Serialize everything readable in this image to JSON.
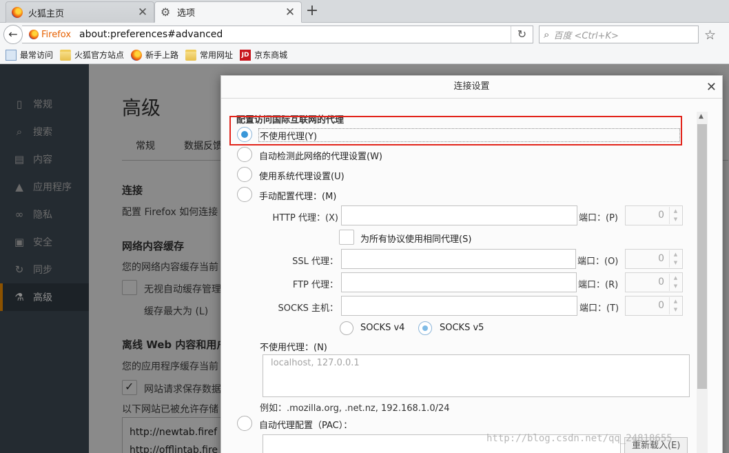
{
  "tabs": [
    {
      "label": "火狐主页",
      "icon": "firefox-logo-icon",
      "close": "✕"
    },
    {
      "label": "选项",
      "icon": "gear-icon",
      "close": "✕"
    }
  ],
  "new_tab_symbol": "+",
  "navbar": {
    "identity_label": "Firefox",
    "url": "about:preferences#advanced",
    "search_placeholder": "百度 <Ctrl+K>"
  },
  "bookmarks": [
    {
      "label": "最常访问",
      "icon": "most-visited-icon"
    },
    {
      "label": "火狐官方站点",
      "icon": "folder-icon"
    },
    {
      "label": "新手上路",
      "icon": "firefox-logo-icon"
    },
    {
      "label": "常用网址",
      "icon": "folder-icon"
    },
    {
      "label": "京东商城",
      "icon": "jd-logo-icon",
      "icon_text": "JD"
    }
  ],
  "sidebar": {
    "items": [
      {
        "label": "常规",
        "icon": "general-icon",
        "glyph": "▯"
      },
      {
        "label": "搜索",
        "icon": "search-icon",
        "glyph": "⌕"
      },
      {
        "label": "内容",
        "icon": "content-icon",
        "glyph": "▤"
      },
      {
        "label": "应用程序",
        "icon": "applications-icon",
        "glyph": "▲"
      },
      {
        "label": "隐私",
        "icon": "privacy-mask-icon",
        "glyph": "∞"
      },
      {
        "label": "安全",
        "icon": "security-lock-icon",
        "glyph": "▣"
      },
      {
        "label": "同步",
        "icon": "sync-icon",
        "glyph": "↻"
      },
      {
        "label": "高级",
        "icon": "advanced-icon",
        "glyph": "⚗",
        "selected": true
      }
    ]
  },
  "pane": {
    "title": "高级",
    "tabs": [
      "常规",
      "数据反馈"
    ],
    "connection_heading": "连接",
    "connection_desc": "配置 Firefox 如何连接",
    "cache_heading": "网络内容缓存",
    "cache_desc": "您的网络内容缓存当前",
    "cache_override": "无视自动缓存管理",
    "cache_limit": "缓存最大为 (L)",
    "offline_heading": "离线 Web 内容和用户",
    "offline_desc": "您的应用程序缓存当前",
    "offline_notify": "网站请求保存数据",
    "offline_allowed": "以下网站已被允许存储",
    "offline_sites": [
      "http://newtab.firef",
      "http://offlintab.fire"
    ]
  },
  "dialog": {
    "title": "连接设置",
    "close": "✕",
    "group_label": "配置访问国际互联网的代理",
    "proxy_options": [
      {
        "label": "不使用代理(Y)",
        "selected": true
      },
      {
        "label": "自动检测此网络的代理设置(W)",
        "selected": false
      },
      {
        "label": "使用系统代理设置(U)",
        "selected": false
      },
      {
        "label": "手动配置代理：(M)",
        "selected": false
      }
    ],
    "http_label": "HTTP 代理：(X)",
    "ssl_label": "SSL 代理：",
    "ftp_label": "FTP 代理：",
    "socks_label": "SOCKS 主机：",
    "port_labels": [
      "端口：(P)",
      "端口：(O)",
      "端口：(R)",
      "端口：(T)"
    ],
    "port_values": [
      "0",
      "0",
      "0",
      "0"
    ],
    "share_proxy": "为所有协议使用相同代理(S)",
    "socks_versions": [
      {
        "label": "SOCKS v4",
        "selected": false
      },
      {
        "label": "SOCKS v5",
        "selected": true
      }
    ],
    "no_proxy_label": "不使用代理：(N)",
    "no_proxy_value": "localhost, 127.0.0.1",
    "example": "例如：.mozilla.org, .net.nz, 192.168.1.0/24",
    "pac_label": "自动代理配置（PAC）：",
    "reload_button": "重新载入(E)"
  },
  "watermark": "http://blog.csdn.net/qq_24818655",
  "colors": {
    "accent": "#3a97d8",
    "sidebar": "#424f5a",
    "highlight": "#e2231a",
    "firefox": "#e66000"
  }
}
